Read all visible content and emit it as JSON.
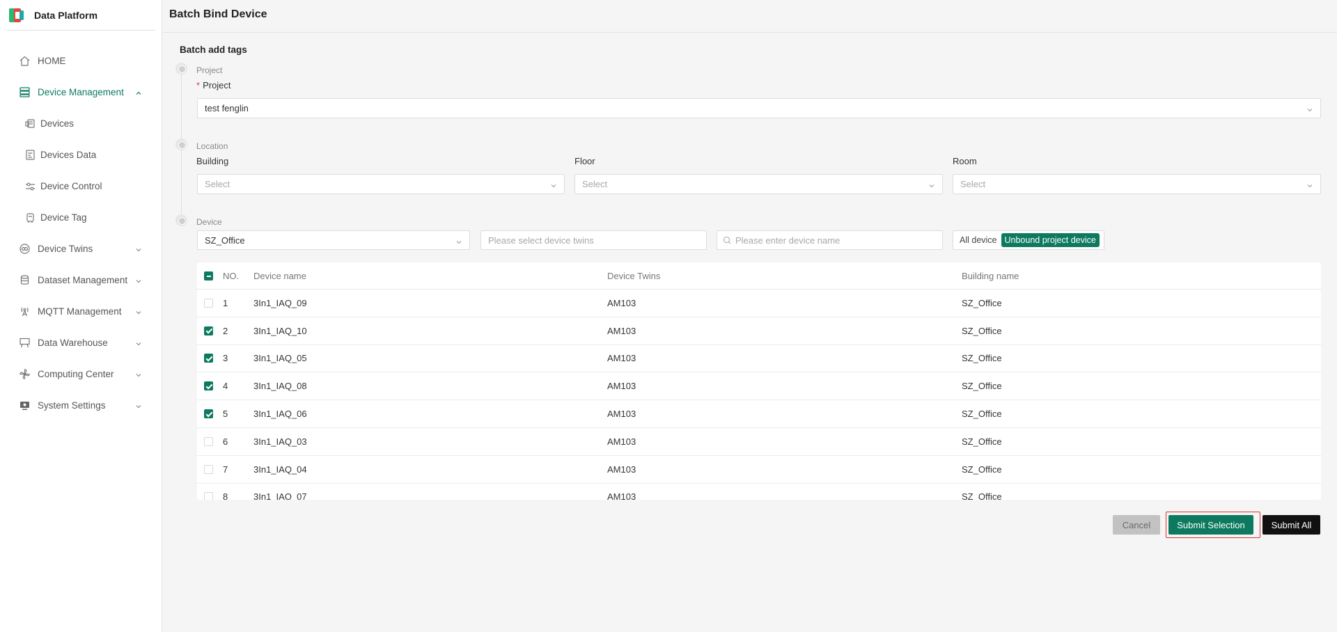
{
  "brand": {
    "title": "Data Platform"
  },
  "sidebar": {
    "items": [
      {
        "label": "HOME"
      },
      {
        "label": "Device Management"
      },
      {
        "label": "Devices"
      },
      {
        "label": "Devices Data"
      },
      {
        "label": "Device Control"
      },
      {
        "label": "Device Tag"
      },
      {
        "label": "Device Twins"
      },
      {
        "label": "Dataset Management"
      },
      {
        "label": "MQTT Management"
      },
      {
        "label": "Data Warehouse"
      },
      {
        "label": "Computing Center"
      },
      {
        "label": "System Settings"
      }
    ]
  },
  "header": {
    "title": "Batch Bind Device"
  },
  "section": {
    "title": "Batch add tags"
  },
  "steps": {
    "project": {
      "label": "Project",
      "field_label": "Project",
      "required_mark": "*",
      "value": "test fenglin"
    },
    "location": {
      "label": "Location",
      "building_label": "Building",
      "floor_label": "Floor",
      "room_label": "Room",
      "placeholder": "Select"
    },
    "device": {
      "label": "Device",
      "building_value": "SZ_Office",
      "twins_placeholder": "Please select device twins",
      "name_placeholder": "Please enter device name",
      "toggle_all": "All device",
      "toggle_unbound": "Unbound project device"
    }
  },
  "table": {
    "headers": {
      "no": "NO.",
      "name": "Device name",
      "twins": "Device Twins",
      "building": "Building name"
    },
    "rows": [
      {
        "no": "1",
        "name": "3In1_IAQ_09",
        "twins": "AM103",
        "building": "SZ_Office",
        "checked": false
      },
      {
        "no": "2",
        "name": "3In1_IAQ_10",
        "twins": "AM103",
        "building": "SZ_Office",
        "checked": true
      },
      {
        "no": "3",
        "name": "3In1_IAQ_05",
        "twins": "AM103",
        "building": "SZ_Office",
        "checked": true
      },
      {
        "no": "4",
        "name": "3In1_IAQ_08",
        "twins": "AM103",
        "building": "SZ_Office",
        "checked": true
      },
      {
        "no": "5",
        "name": "3In1_IAQ_06",
        "twins": "AM103",
        "building": "SZ_Office",
        "checked": true
      },
      {
        "no": "6",
        "name": "3In1_IAQ_03",
        "twins": "AM103",
        "building": "SZ_Office",
        "checked": false
      },
      {
        "no": "7",
        "name": "3In1_IAQ_04",
        "twins": "AM103",
        "building": "SZ_Office",
        "checked": false
      },
      {
        "no": "8",
        "name": "3In1_IAQ_07",
        "twins": "AM103",
        "building": "SZ_Office",
        "checked": false
      }
    ]
  },
  "actions": {
    "cancel": "Cancel",
    "submit_selection": "Submit Selection",
    "submit_all": "Submit All"
  },
  "colors": {
    "accent": "#0d7a5f",
    "highlight": "#e03030"
  }
}
